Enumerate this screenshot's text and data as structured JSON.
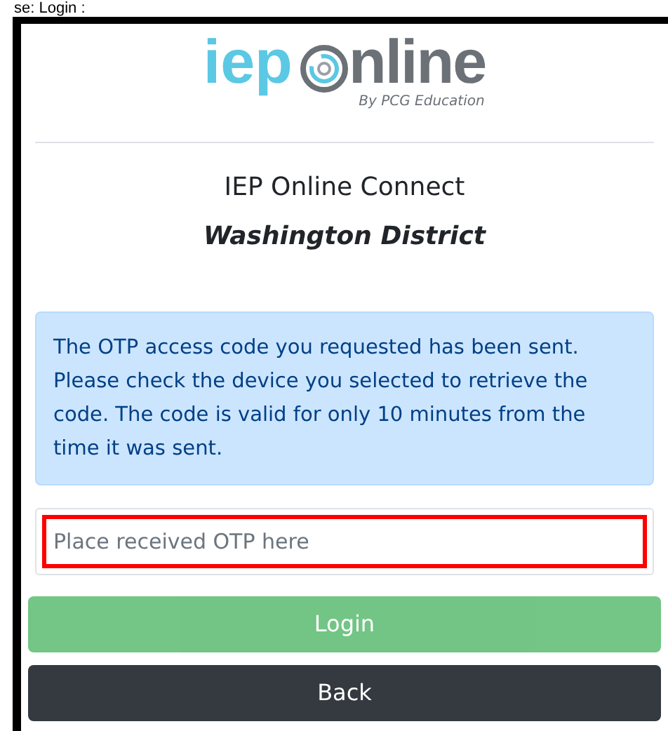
{
  "caption": "se: Login :",
  "logo": {
    "first_word": "iep",
    "second_word_rest": "nline",
    "tagline": "By PCG Education"
  },
  "title": "IEP Online Connect",
  "district": "Washington District",
  "alert": "The OTP access code you requested has been sent. Please check the device you selected to retrieve the code. The code is valid for only 10 minutes from the time it was sent.",
  "otp_field": {
    "placeholder": "Place received OTP here",
    "highlighted": true
  },
  "buttons": [
    {
      "label": "Login",
      "kind": "primary",
      "disabled": true
    },
    {
      "label": "Back",
      "kind": "dark",
      "disabled": false
    }
  ]
}
